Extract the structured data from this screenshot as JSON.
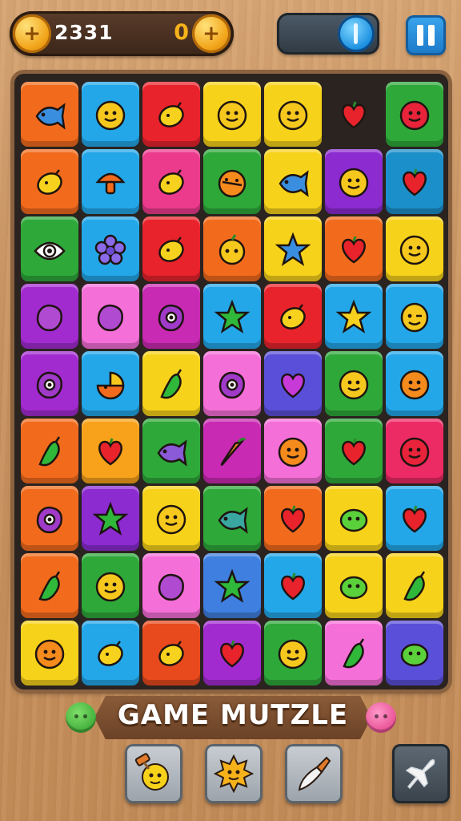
{
  "hud": {
    "score": "2331",
    "combo": "0",
    "coin_left_glyph": "+",
    "coin_right_glyph": "+"
  },
  "title": "GAME MUTZLE",
  "board": {
    "rows": [
      [
        {
          "c": "#f26b1d",
          "i": "fish"
        },
        {
          "c": "#23a7e8",
          "i": "smile"
        },
        {
          "c": "#e8232c",
          "i": "lemon"
        },
        {
          "c": "#f7d21a",
          "i": "smile"
        },
        {
          "c": "#f7d21a",
          "i": "smile"
        },
        {
          "c": "empty",
          "i": "heart"
        },
        {
          "c": "#2fa83a",
          "i": "smile-red"
        }
      ],
      [
        {
          "c": "#f26b1d",
          "i": "lemon"
        },
        {
          "c": "#23a7e8",
          "i": "mushroom"
        },
        {
          "c": "#ec3a8c",
          "i": "lemon"
        },
        {
          "c": "#2fa83a",
          "i": "orange"
        },
        {
          "c": "#f7d21a",
          "i": "fish"
        },
        {
          "c": "#8b2bd0",
          "i": "smile"
        },
        {
          "c": "#1b8fc9",
          "i": "heart"
        }
      ],
      [
        {
          "c": "#2fa83a",
          "i": "eye"
        },
        {
          "c": "#23a7e8",
          "i": "flower"
        },
        {
          "c": "#e8232c",
          "i": "lemon"
        },
        {
          "c": "#f26b1d",
          "i": "apple"
        },
        {
          "c": "#f7d21a",
          "i": "star-blue"
        },
        {
          "c": "#f26b1d",
          "i": "heart"
        },
        {
          "c": "#f7d21a",
          "i": "smile"
        }
      ],
      [
        {
          "c": "#a22bd0",
          "i": "plum"
        },
        {
          "c": "#f56fd8",
          "i": "plum"
        },
        {
          "c": "#c92ab3",
          "i": "plum-eye"
        },
        {
          "c": "#23a7e8",
          "i": "star-green"
        },
        {
          "c": "#e8232c",
          "i": "lemon"
        },
        {
          "c": "#23a7e8",
          "i": "star-yellow"
        },
        {
          "c": "#23a7e8",
          "i": "wink"
        }
      ],
      [
        {
          "c": "#a22bd0",
          "i": "plum-eye"
        },
        {
          "c": "#23a7e8",
          "i": "orange-bite"
        },
        {
          "c": "#f7d21a",
          "i": "pepper"
        },
        {
          "c": "#f56fd8",
          "i": "plum-eye"
        },
        {
          "c": "#5a4fd8",
          "i": "heart-purple"
        },
        {
          "c": "#2fa83a",
          "i": "smile"
        },
        {
          "c": "#23a7e8",
          "i": "smile-orange"
        }
      ],
      [
        {
          "c": "#f26b1d",
          "i": "pepper"
        },
        {
          "c": "#f7a21a",
          "i": "heart"
        },
        {
          "c": "#2fa83a",
          "i": "fish-purple"
        },
        {
          "c": "#c92ab3",
          "i": "carrot"
        },
        {
          "c": "#f56fd8",
          "i": "smile-orange"
        },
        {
          "c": "#2fa83a",
          "i": "heart"
        },
        {
          "c": "#ec2a64",
          "i": "smile-red"
        }
      ],
      [
        {
          "c": "#f26b1d",
          "i": "plum-eye"
        },
        {
          "c": "#8b2bd0",
          "i": "star-green"
        },
        {
          "c": "#f7d21a",
          "i": "smile"
        },
        {
          "c": "#2fa83a",
          "i": "fish-teal"
        },
        {
          "c": "#f26b1d",
          "i": "heart"
        },
        {
          "c": "#f7d21a",
          "i": "lime"
        },
        {
          "c": "#23a7e8",
          "i": "heart"
        }
      ],
      [
        {
          "c": "#f26b1d",
          "i": "pepper"
        },
        {
          "c": "#2fa83a",
          "i": "smile"
        },
        {
          "c": "#f56fd8",
          "i": "plum"
        },
        {
          "c": "#3f7fe0",
          "i": "star-green"
        },
        {
          "c": "#23a7e8",
          "i": "heart"
        },
        {
          "c": "#f7d21a",
          "i": "lime"
        },
        {
          "c": "#f7d21a",
          "i": "pepper"
        }
      ],
      [
        {
          "c": "#f7d21a",
          "i": "smile-orange"
        },
        {
          "c": "#23a7e8",
          "i": "lemon"
        },
        {
          "c": "#e84a1d",
          "i": "lemon"
        },
        {
          "c": "#a22bd0",
          "i": "heart"
        },
        {
          "c": "#2fa83a",
          "i": "smile"
        },
        {
          "c": "#f56fd8",
          "i": "pepper"
        },
        {
          "c": "#5a4fd8",
          "i": "lime"
        }
      ]
    ]
  },
  "toolbar": {
    "tools": [
      {
        "name": "hammer-tool-button",
        "icon": "hammer-icon"
      },
      {
        "name": "bomb-tool-button",
        "icon": "sun-bomb-icon"
      },
      {
        "name": "brush-tool-button",
        "icon": "brush-icon"
      },
      {
        "name": "plane-tool-button",
        "icon": "plane-icon"
      }
    ]
  }
}
